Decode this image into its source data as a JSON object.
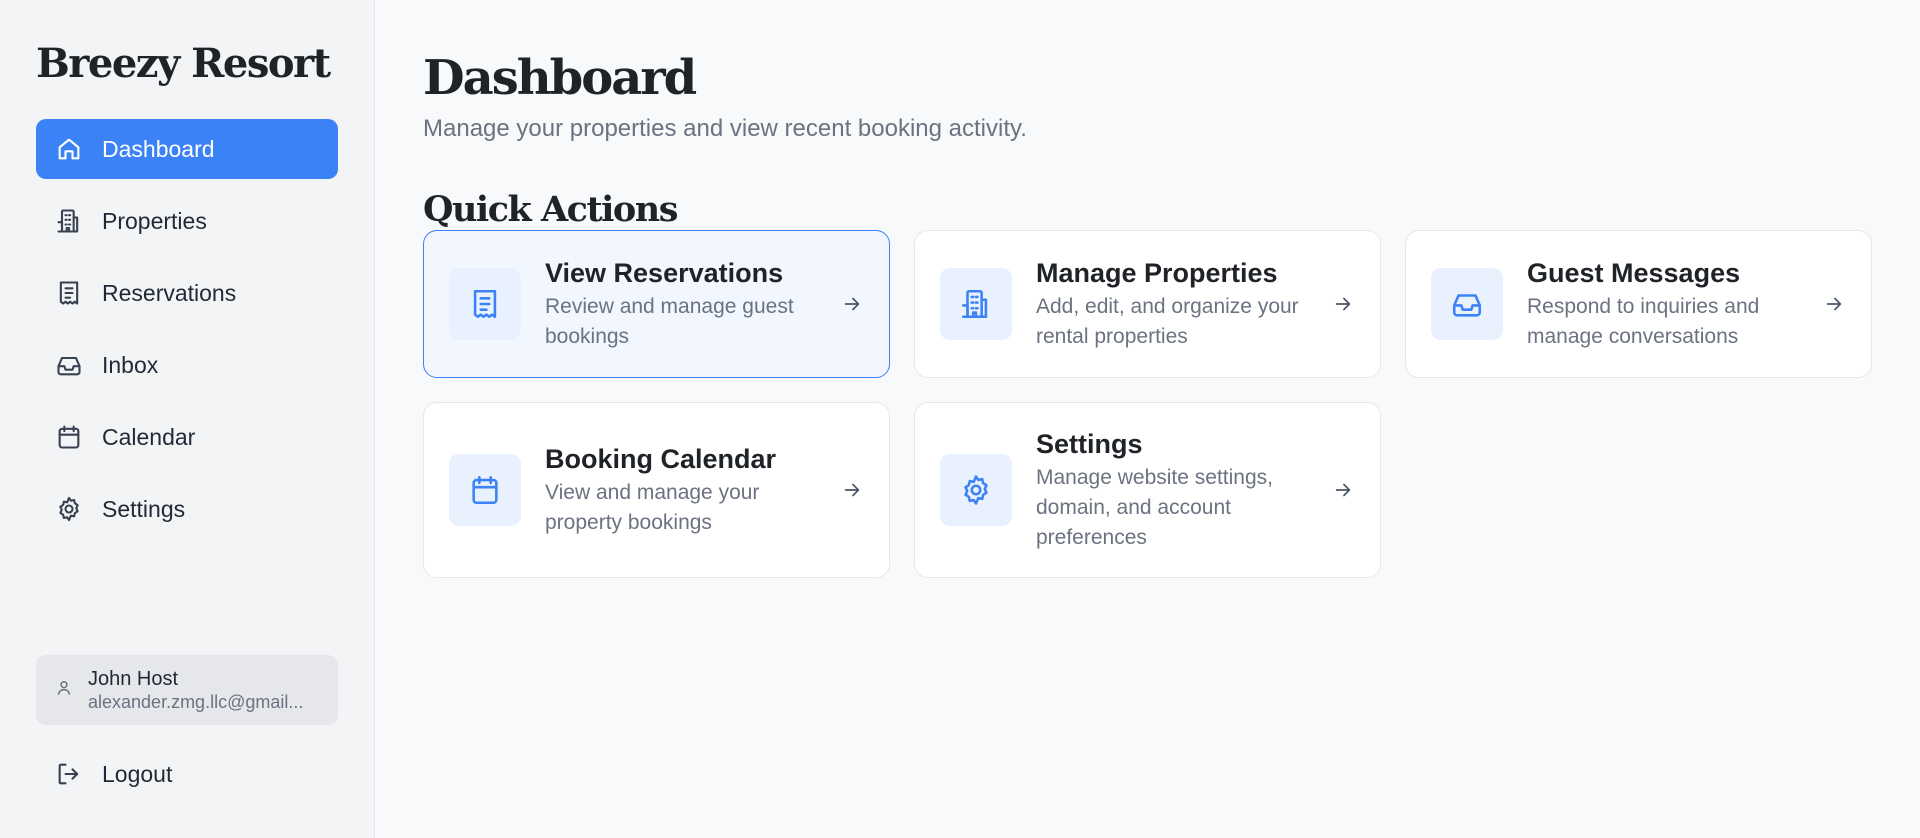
{
  "app": {
    "brand": "Breezy Resort"
  },
  "sidebar": {
    "items": [
      {
        "label": "Dashboard",
        "icon": "home-icon",
        "active": true
      },
      {
        "label": "Properties",
        "icon": "building-icon"
      },
      {
        "label": "Reservations",
        "icon": "receipt-icon"
      },
      {
        "label": "Inbox",
        "icon": "inbox-icon"
      },
      {
        "label": "Calendar",
        "icon": "calendar-icon"
      },
      {
        "label": "Settings",
        "icon": "gear-icon"
      }
    ],
    "user": {
      "name": "John Host",
      "email": "alexander.zmg.llc@gmail...",
      "icon": "user-icon"
    },
    "logout": {
      "label": "Logout",
      "icon": "logout-icon"
    }
  },
  "main": {
    "title": "Dashboard",
    "subtitle": "Manage your properties and view recent booking activity.",
    "section_title": "Quick Actions",
    "cards": [
      {
        "title": "View Reservations",
        "desc": "Review and manage guest bookings",
        "icon": "receipt-icon"
      },
      {
        "title": "Manage Properties",
        "desc": "Add, edit, and organize your rental properties",
        "icon": "building-icon"
      },
      {
        "title": "Guest Messages",
        "desc": "Respond to inquiries and manage conversations",
        "icon": "inbox-icon"
      },
      {
        "title": "Booking Calendar",
        "desc": "View and manage your property bookings",
        "icon": "calendar-icon"
      },
      {
        "title": "Settings",
        "desc": "Manage website settings, domain, and account preferences",
        "icon": "gear-icon"
      }
    ]
  },
  "colors": {
    "accent": "#3b82f6",
    "sidebar_bg": "#f3f4f6",
    "page_bg": "#f8f9fb"
  }
}
